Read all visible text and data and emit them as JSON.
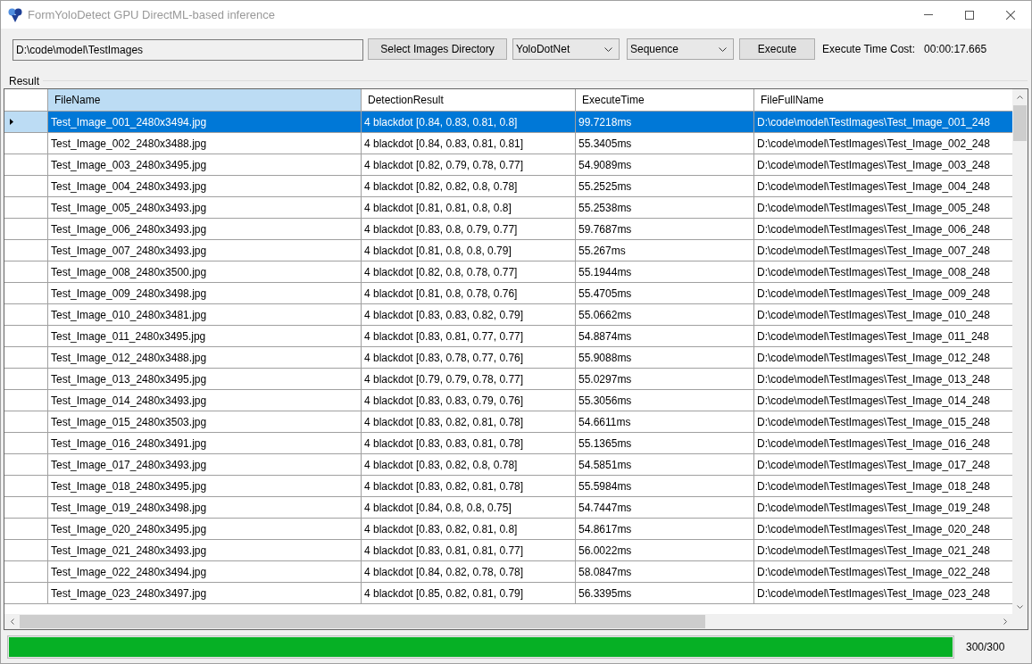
{
  "window": {
    "title": "FormYoloDetect GPU DirectML-based inference"
  },
  "toolbar": {
    "directory_path": "D:\\code\\model\\TestImages",
    "select_button": "Select Images Directory",
    "model_dropdown": "YoloDotNet",
    "mode_dropdown": "Sequence",
    "execute_button": "Execute",
    "time_cost_label": "Execute Time Cost:",
    "time_cost_value": "00:00:17.665"
  },
  "result": {
    "title": "Result",
    "columns": [
      {
        "label": "FileName",
        "selected": true
      },
      {
        "label": "DetectionResult",
        "selected": false
      },
      {
        "label": "ExecuteTime",
        "selected": false
      },
      {
        "label": "FileFullName",
        "selected": false
      }
    ],
    "rows": [
      {
        "selected": true,
        "cells": [
          "Test_Image_001_2480x3494.jpg",
          "4 blackdot [0.84, 0.83, 0.81, 0.8]",
          "99.7218ms",
          "D:\\code\\model\\TestImages\\Test_Image_001_248"
        ]
      },
      {
        "selected": false,
        "cells": [
          "Test_Image_002_2480x3488.jpg",
          "4 blackdot [0.84, 0.83, 0.81, 0.81]",
          "55.3405ms",
          "D:\\code\\model\\TestImages\\Test_Image_002_248"
        ]
      },
      {
        "selected": false,
        "cells": [
          "Test_Image_003_2480x3495.jpg",
          "4 blackdot [0.82, 0.79, 0.78, 0.77]",
          "54.9089ms",
          "D:\\code\\model\\TestImages\\Test_Image_003_248"
        ]
      },
      {
        "selected": false,
        "cells": [
          "Test_Image_004_2480x3493.jpg",
          "4 blackdot [0.82, 0.82, 0.8, 0.78]",
          "55.2525ms",
          "D:\\code\\model\\TestImages\\Test_Image_004_248"
        ]
      },
      {
        "selected": false,
        "cells": [
          "Test_Image_005_2480x3493.jpg",
          "4 blackdot [0.81, 0.81, 0.8, 0.8]",
          "55.2538ms",
          "D:\\code\\model\\TestImages\\Test_Image_005_248"
        ]
      },
      {
        "selected": false,
        "cells": [
          "Test_Image_006_2480x3493.jpg",
          "4 blackdot [0.83, 0.8, 0.79, 0.77]",
          "59.7687ms",
          "D:\\code\\model\\TestImages\\Test_Image_006_248"
        ]
      },
      {
        "selected": false,
        "cells": [
          "Test_Image_007_2480x3493.jpg",
          "4 blackdot [0.81, 0.8, 0.8, 0.79]",
          "55.267ms",
          "D:\\code\\model\\TestImages\\Test_Image_007_248"
        ]
      },
      {
        "selected": false,
        "cells": [
          "Test_Image_008_2480x3500.jpg",
          "4 blackdot [0.82, 0.8, 0.78, 0.77]",
          "55.1944ms",
          "D:\\code\\model\\TestImages\\Test_Image_008_248"
        ]
      },
      {
        "selected": false,
        "cells": [
          "Test_Image_009_2480x3498.jpg",
          "4 blackdot [0.81, 0.8, 0.78, 0.76]",
          "55.4705ms",
          "D:\\code\\model\\TestImages\\Test_Image_009_248"
        ]
      },
      {
        "selected": false,
        "cells": [
          "Test_Image_010_2480x3481.jpg",
          "4 blackdot [0.83, 0.83, 0.82, 0.79]",
          "55.0662ms",
          "D:\\code\\model\\TestImages\\Test_Image_010_248"
        ]
      },
      {
        "selected": false,
        "cells": [
          "Test_Image_011_2480x3495.jpg",
          "4 blackdot [0.83, 0.81, 0.77, 0.77]",
          "54.8874ms",
          "D:\\code\\model\\TestImages\\Test_Image_011_248"
        ]
      },
      {
        "selected": false,
        "cells": [
          "Test_Image_012_2480x3488.jpg",
          "4 blackdot [0.83, 0.78, 0.77, 0.76]",
          "55.9088ms",
          "D:\\code\\model\\TestImages\\Test_Image_012_248"
        ]
      },
      {
        "selected": false,
        "cells": [
          "Test_Image_013_2480x3495.jpg",
          "4 blackdot [0.79, 0.79, 0.78, 0.77]",
          "55.0297ms",
          "D:\\code\\model\\TestImages\\Test_Image_013_248"
        ]
      },
      {
        "selected": false,
        "cells": [
          "Test_Image_014_2480x3493.jpg",
          "4 blackdot [0.83, 0.83, 0.79, 0.76]",
          "55.3056ms",
          "D:\\code\\model\\TestImages\\Test_Image_014_248"
        ]
      },
      {
        "selected": false,
        "cells": [
          "Test_Image_015_2480x3503.jpg",
          "4 blackdot [0.83, 0.82, 0.81, 0.78]",
          "54.6611ms",
          "D:\\code\\model\\TestImages\\Test_Image_015_248"
        ]
      },
      {
        "selected": false,
        "cells": [
          "Test_Image_016_2480x3491.jpg",
          "4 blackdot [0.83, 0.83, 0.81, 0.78]",
          "55.1365ms",
          "D:\\code\\model\\TestImages\\Test_Image_016_248"
        ]
      },
      {
        "selected": false,
        "cells": [
          "Test_Image_017_2480x3493.jpg",
          "4 blackdot [0.83, 0.82, 0.8, 0.78]",
          "54.5851ms",
          "D:\\code\\model\\TestImages\\Test_Image_017_248"
        ]
      },
      {
        "selected": false,
        "cells": [
          "Test_Image_018_2480x3495.jpg",
          "4 blackdot [0.83, 0.82, 0.81, 0.78]",
          "55.5984ms",
          "D:\\code\\model\\TestImages\\Test_Image_018_248"
        ]
      },
      {
        "selected": false,
        "cells": [
          "Test_Image_019_2480x3498.jpg",
          "4 blackdot [0.84, 0.8, 0.8, 0.75]",
          "54.7447ms",
          "D:\\code\\model\\TestImages\\Test_Image_019_248"
        ]
      },
      {
        "selected": false,
        "cells": [
          "Test_Image_020_2480x3495.jpg",
          "4 blackdot [0.83, 0.82, 0.81, 0.8]",
          "54.8617ms",
          "D:\\code\\model\\TestImages\\Test_Image_020_248"
        ]
      },
      {
        "selected": false,
        "cells": [
          "Test_Image_021_2480x3493.jpg",
          "4 blackdot [0.83, 0.81, 0.81, 0.77]",
          "56.0022ms",
          "D:\\code\\model\\TestImages\\Test_Image_021_248"
        ]
      },
      {
        "selected": false,
        "cells": [
          "Test_Image_022_2480x3494.jpg",
          "4 blackdot [0.84, 0.82, 0.78, 0.78]",
          "58.0847ms",
          "D:\\code\\model\\TestImages\\Test_Image_022_248"
        ]
      },
      {
        "selected": false,
        "cells": [
          "Test_Image_023_2480x3497.jpg",
          "4 blackdot [0.85, 0.82, 0.81, 0.79]",
          "56.3395ms",
          "D:\\code\\model\\TestImages\\Test_Image_023_248"
        ]
      }
    ]
  },
  "progress": {
    "level": 1,
    "count": "300/300"
  }
}
